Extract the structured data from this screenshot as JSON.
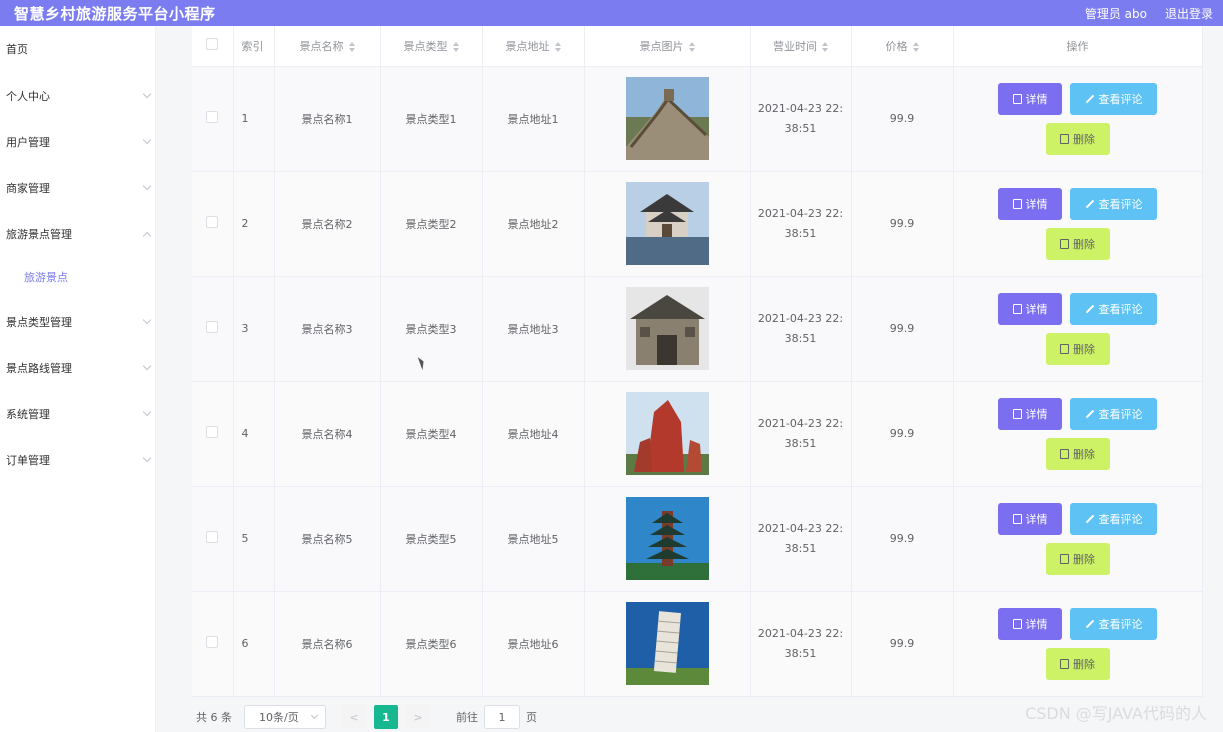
{
  "header": {
    "title": "智慧乡村旅游服务平台小程序",
    "user": "管理员 abo",
    "logout": "退出登录",
    "accent": "#7b7cf0"
  },
  "sidebar": {
    "items": [
      {
        "label": "首页"
      },
      {
        "label": "个人中心"
      },
      {
        "label": "用户管理"
      },
      {
        "label": "商家管理"
      },
      {
        "label": "旅游景点管理",
        "expanded": true
      },
      {
        "label": "旅游景点",
        "sub": true
      },
      {
        "label": "景点类型管理"
      },
      {
        "label": "景点路线管理"
      },
      {
        "label": "系统管理"
      },
      {
        "label": "订单管理"
      }
    ]
  },
  "table": {
    "columns": [
      "索引",
      "景点名称",
      "景点类型",
      "景点地址",
      "景点图片",
      "营业时间",
      "价格",
      "操作"
    ],
    "rows": [
      {
        "index": "1",
        "name": "景点名称1",
        "type": "景点类型1",
        "address": "景点地址1",
        "time_a": "2021-04-23 22:",
        "time_b": "38:51",
        "price": "99.9",
        "image": "great-wall-photo"
      },
      {
        "index": "2",
        "name": "景点名称2",
        "type": "景点类型2",
        "address": "景点地址2",
        "time_a": "2021-04-23 22:",
        "time_b": "38:51",
        "price": "99.9",
        "image": "pavilion-photo"
      },
      {
        "index": "3",
        "name": "景点名称3",
        "type": "景点类型3",
        "address": "景点地址3",
        "time_a": "2021-04-23 22:",
        "time_b": "38:51",
        "price": "99.9",
        "image": "archway-photo"
      },
      {
        "index": "4",
        "name": "景点名称4",
        "type": "景点类型4",
        "address": "景点地址4",
        "time_a": "2021-04-23 22:",
        "time_b": "38:51",
        "price": "99.9",
        "image": "red-rock-photo"
      },
      {
        "index": "5",
        "name": "景点名称5",
        "type": "景点类型5",
        "address": "景点地址5",
        "time_a": "2021-04-23 22:",
        "time_b": "38:51",
        "price": "99.9",
        "image": "pagoda-photo"
      },
      {
        "index": "6",
        "name": "景点名称6",
        "type": "景点类型6",
        "address": "景点地址6",
        "time_a": "2021-04-23 22:",
        "time_b": "38:51",
        "price": "99.9",
        "image": "leaning-tower-photo"
      }
    ],
    "actions": {
      "detail": "详情",
      "comment": "查看评论",
      "delete": "删除"
    }
  },
  "pager": {
    "total": "共 6 条",
    "size": "10条/页",
    "prev": "<",
    "current": "1",
    "next": ">",
    "goto": "前往",
    "goto_value": "1",
    "goto_suffix": "页"
  },
  "watermark": "CSDN @写JAVA代码的人"
}
